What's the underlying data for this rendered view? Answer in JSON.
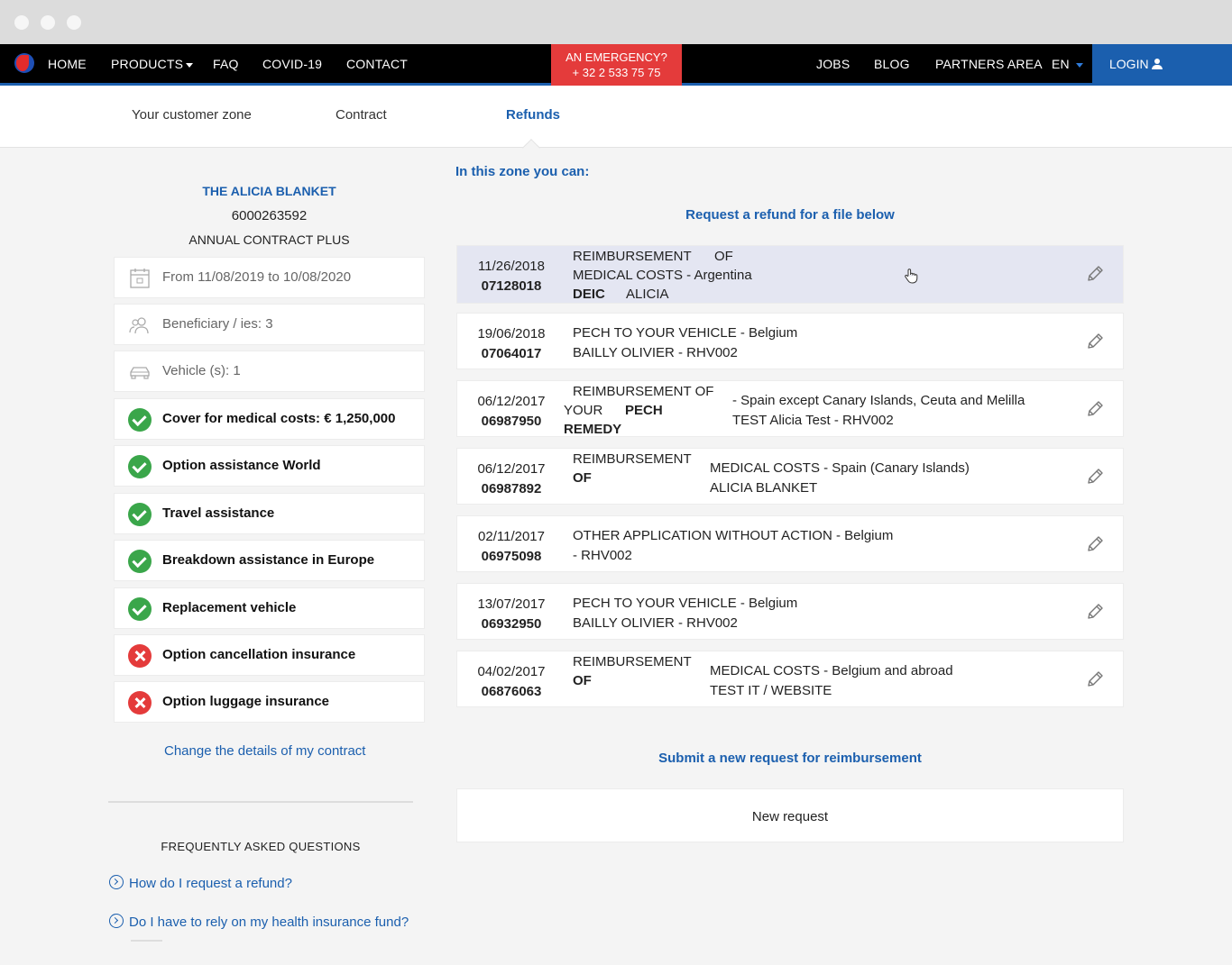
{
  "nav": {
    "home": "HOME",
    "products": "PRODUCTS",
    "faq": "FAQ",
    "covid": "COVID-19",
    "contact": "CONTACT",
    "emergency_line1": "AN EMERGENCY?",
    "emergency_line2": "+ 32 2 533 75 75",
    "jobs": "JOBS",
    "blog": "BLOG",
    "partners": "PARTNERS AREA",
    "lang": "EN",
    "login": "LOGIN"
  },
  "tabs": {
    "customer_zone": "Your customer zone",
    "contract": "Contract",
    "refunds": "Refunds"
  },
  "contract": {
    "holder": "THE ALICIA BLANKET",
    "number": "6000263592",
    "plan": "ANNUAL CONTRACT PLUS",
    "period": "From 11/08/2019 to 10/08/2020",
    "beneficiaries": "Beneficiary / ies: 3",
    "vehicles": "Vehicle (s): 1",
    "coverages": [
      {
        "label": "Cover for medical costs: € 1,250,000",
        "status": "included"
      },
      {
        "label": "Option assistance World",
        "status": "included"
      },
      {
        "label": "Travel assistance",
        "status": "included"
      },
      {
        "label": "Breakdown assistance in Europe",
        "status": "included"
      },
      {
        "label": "Replacement vehicle",
        "status": "included"
      },
      {
        "label": "Option cancellation insurance",
        "status": "excluded"
      },
      {
        "label": "Option luggage insurance",
        "status": "excluded"
      }
    ],
    "change_link": "Change the details of my contract"
  },
  "faq": {
    "title": "FREQUENTLY ASKED QUESTIONS",
    "items": [
      "How do I request a refund?",
      "Do I have to rely on my health insurance fund?"
    ]
  },
  "main": {
    "zone_heading": "In this zone you can:",
    "request_heading": "Request a refund for a file below",
    "files": [
      {
        "date": "11/26/2018",
        "num": "07128018",
        "a1": "REIMBURSEMENT",
        "a2": "OF",
        "b1": "MEDICAL COSTS - Argentina",
        "c1": "DEIC",
        "c2": "ALICIA"
      },
      {
        "date": "19/06/2018",
        "num": "07064017",
        "l1": "PECH TO YOUR VEHICLE - Belgium",
        "l2": "BAILLY OLIVIER - RHV002"
      },
      {
        "date": "06/12/2017",
        "num": "06987950",
        "a1": "REIMBURSEMENT OF",
        "a2": "YOUR",
        "a3": "PECH",
        "a4": "REMEDY",
        "r1": "- Spain except Canary Islands, Ceuta and Melilla",
        "r2": "TEST Alicia Test - RHV002"
      },
      {
        "date": "06/12/2017",
        "num": "06987892",
        "a1": "REIMBURSEMENT",
        "a2": "OF",
        "r1": "MEDICAL COSTS - Spain (Canary Islands)",
        "r2": "ALICIA BLANKET"
      },
      {
        "date": "02/11/2017",
        "num": "06975098",
        "l1": "OTHER APPLICATION WITHOUT ACTION - Belgium",
        "l2": "- RHV002"
      },
      {
        "date": "13/07/2017",
        "num": "06932950",
        "l1": "PECH TO YOUR VEHICLE - Belgium",
        "l2": "BAILLY OLIVIER - RHV002"
      },
      {
        "date": "04/02/2017",
        "num": "06876063",
        "a1": "REIMBURSEMENT",
        "a2": "OF",
        "r1": "MEDICAL COSTS - Belgium and abroad",
        "r2": "TEST IT / WEBSITE"
      }
    ],
    "submit_heading": "Submit a new request for reimbursement",
    "new_request": "New request"
  },
  "colors": {
    "brand_blue": "#1b5fae",
    "emergency_red": "#e43b3b",
    "ok_green": "#3aa64a"
  }
}
